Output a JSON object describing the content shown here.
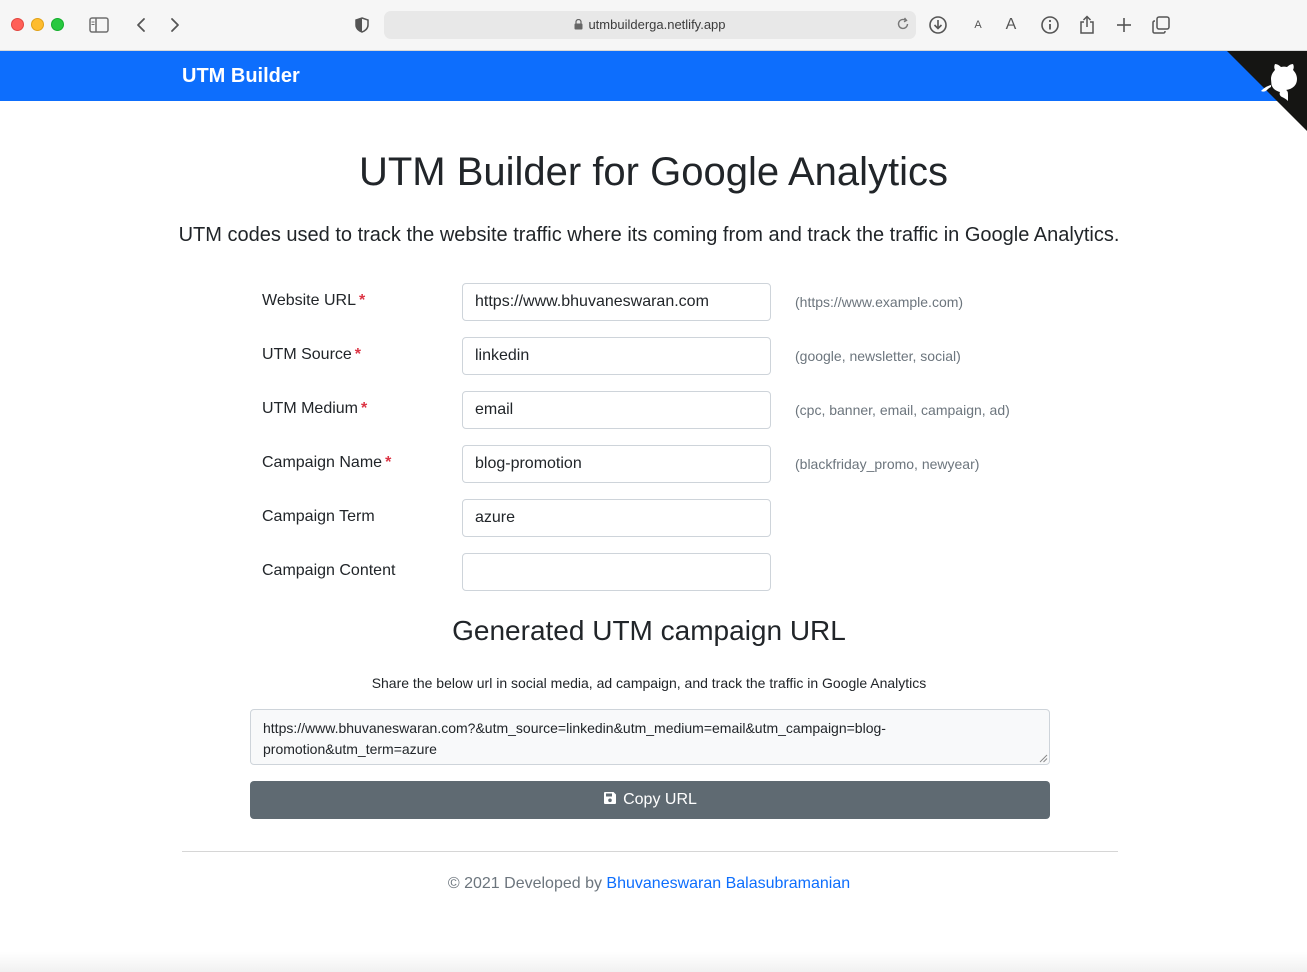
{
  "browser": {
    "url": "utmbuilderga.netlify.app"
  },
  "navbar": {
    "brand": "UTM Builder"
  },
  "page": {
    "title": "UTM Builder for Google Analytics",
    "lead": "UTM codes used to track the website traffic where its coming from and track the traffic in Google Analytics."
  },
  "form": {
    "rows": [
      {
        "label": "Website URL",
        "required": "*",
        "value": "https://www.bhuvaneswaran.com",
        "hint": "(https://www.example.com)"
      },
      {
        "label": "UTM Source",
        "required": "*",
        "value": "linkedin",
        "hint": "(google, newsletter, social)"
      },
      {
        "label": "UTM Medium",
        "required": "*",
        "value": "email",
        "hint": "(cpc, banner, email, campaign, ad)"
      },
      {
        "label": "Campaign Name",
        "required": "*",
        "value": "blog-promotion",
        "hint": "(blackfriday_promo, newyear)"
      },
      {
        "label": "Campaign Term",
        "value": "azure"
      },
      {
        "label": "Campaign Content",
        "value": ""
      }
    ]
  },
  "generated": {
    "heading": "Generated UTM campaign URL",
    "share_text": "Share the below url in social media, ad campaign, and track the traffic in Google Analytics",
    "url": "https://www.bhuvaneswaran.com?&utm_source=linkedin&utm_medium=email&utm_campaign=blog-promotion&utm_term=azure",
    "copy_label": "Copy URL"
  },
  "footer": {
    "prefix": "© 2021 Developed by ",
    "author": "Bhuvaneswaran Balasubramanian"
  },
  "colors": {
    "navbar": "#0d6efd",
    "required": "#dc3545",
    "copy_button": "#5f6a72",
    "link": "#0d6efd"
  },
  "icons": [
    "sidebar-icon",
    "back-icon",
    "forward-icon",
    "shield-icon",
    "lock-icon",
    "reload-icon",
    "download-icon",
    "font-smaller-icon",
    "font-larger-icon",
    "info-icon",
    "share-icon",
    "new-tab-icon",
    "tab-overview-icon",
    "github-icon",
    "save-icon"
  ]
}
